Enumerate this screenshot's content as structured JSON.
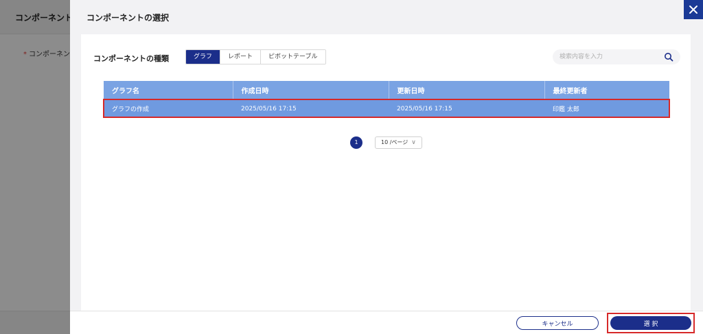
{
  "background": {
    "title": "コンポーネント設定",
    "field_required_mark": "*",
    "field_label": "コンポーネント"
  },
  "drawer": {
    "title": "コンポーネントの選択",
    "close_icon": "close-icon",
    "type_label": "コンポーネントの種類",
    "tabs": [
      {
        "label": "グラフ",
        "active": true
      },
      {
        "label": "レポート",
        "active": false
      },
      {
        "label": "ピボットテーブル",
        "active": false
      }
    ],
    "search": {
      "placeholder": "検索内容を入力",
      "value": "",
      "icon": "search-icon"
    },
    "table": {
      "columns": [
        "グラフ名",
        "作成日時",
        "更新日時",
        "最終更新者"
      ],
      "rows": [
        [
          "グラフの作成",
          "2025/05/16 17:15",
          "2025/05/16 17:15",
          "印鑑 太郎"
        ]
      ]
    },
    "pagination": {
      "current_page": "1",
      "page_size": "10 /ページ"
    },
    "footer": {
      "cancel_label": "キャンセル",
      "select_label": "選 択"
    }
  },
  "colors": {
    "primary": "#1b2e8a",
    "table_header": "#7aa3e3",
    "table_row_selected": "#6f9ae0",
    "highlight": "#d62828"
  }
}
